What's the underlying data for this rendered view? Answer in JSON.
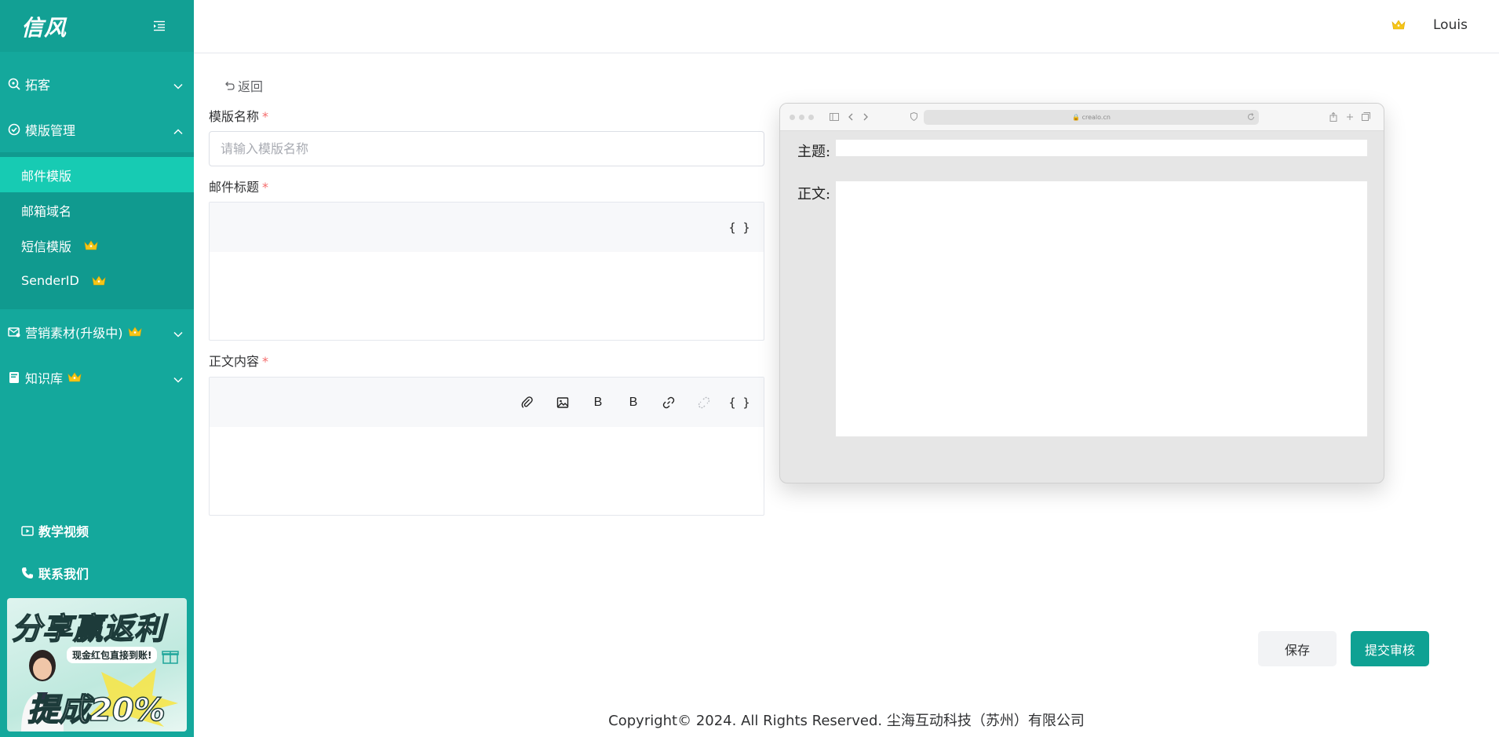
{
  "app": {
    "logo": "信风"
  },
  "header": {
    "username": "Louis"
  },
  "sidebar": {
    "groups": [
      {
        "label": "拓客",
        "expanded": false,
        "premium": false
      },
      {
        "label": "模版管理",
        "expanded": true,
        "premium": false,
        "items": [
          {
            "label": "邮件模版",
            "active": true,
            "premium": false
          },
          {
            "label": "邮箱域名",
            "active": false,
            "premium": false
          },
          {
            "label": "短信模版",
            "active": false,
            "premium": true
          },
          {
            "label": "SenderID",
            "active": false,
            "premium": true
          }
        ]
      },
      {
        "label": "营销素材(升级中)",
        "expanded": false,
        "premium": true
      },
      {
        "label": "知识库",
        "expanded": false,
        "premium": true
      }
    ],
    "bottom_links": [
      {
        "label": "教学视频"
      },
      {
        "label": "联系我们"
      }
    ],
    "promo": {
      "title": "分享赢返利",
      "subtitle": "现金红包直接到账!",
      "highlight": "提成20%"
    }
  },
  "form": {
    "back_label": "返回",
    "name": {
      "label": "模版名称",
      "placeholder": "请输入模版名称",
      "value": ""
    },
    "subject": {
      "label": "邮件标题",
      "toolbar": [
        "{ }"
      ]
    },
    "body": {
      "label": "正文内容",
      "toolbar": [
        "attach-icon",
        "image-icon",
        "B",
        "B",
        "link-icon",
        "unlink-icon",
        "{ }"
      ]
    },
    "required_mark": "*"
  },
  "preview": {
    "url": "🔒 crealo.cn",
    "subject_label": "主题:",
    "body_label": "正文:"
  },
  "actions": {
    "save": "保存",
    "submit": "提交审核"
  },
  "footer": {
    "text": "Copyright© 2024. All Rights Reserved. 尘海互动科技（苏州）有限公司"
  },
  "colors": {
    "sidebar": "#14a89c",
    "active": "#17cbb3",
    "primary": "#0fa193",
    "crown": "#f5c518",
    "required": "#f56c6c"
  }
}
